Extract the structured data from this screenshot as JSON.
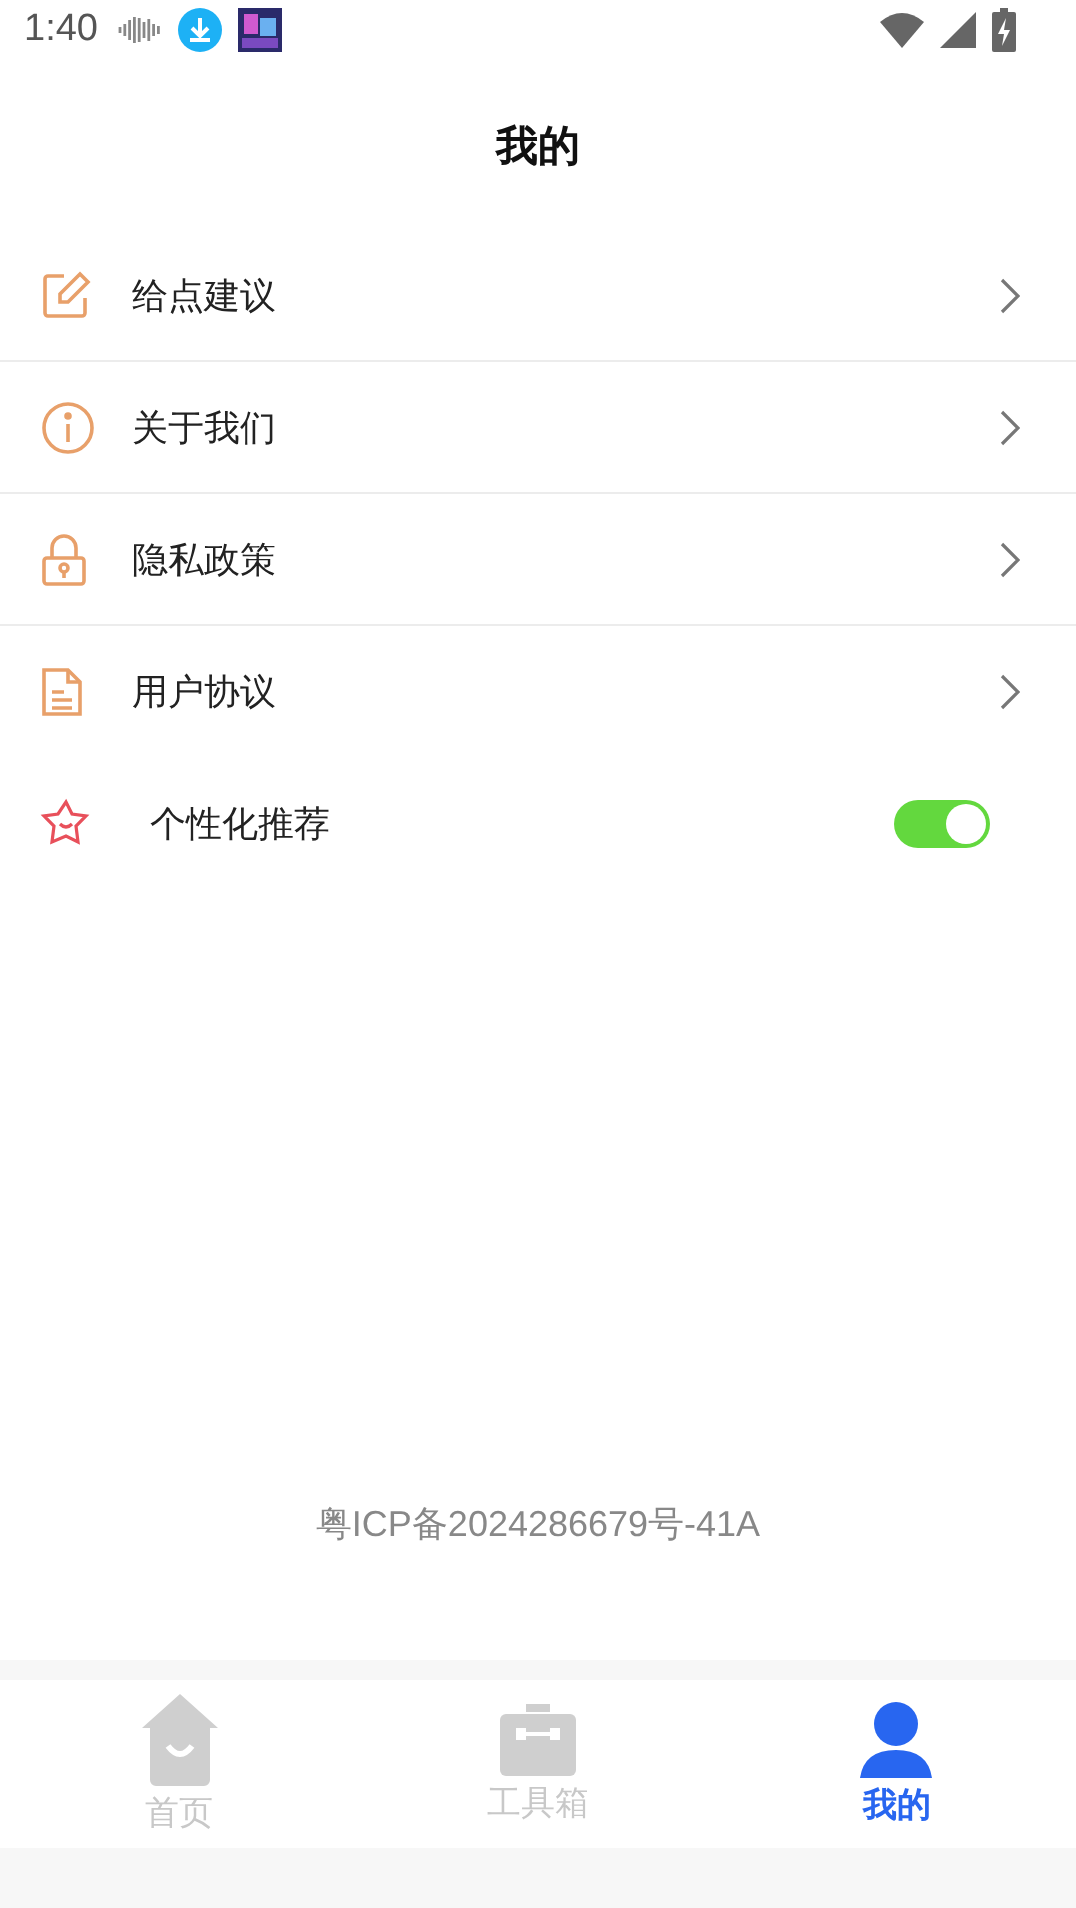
{
  "status_bar": {
    "time": "1:40"
  },
  "header": {
    "title": "我的"
  },
  "menu": [
    {
      "kind": "link",
      "label": "给点建议"
    },
    {
      "kind": "link",
      "label": "关于我们"
    },
    {
      "kind": "link",
      "label": "隐私政策"
    },
    {
      "kind": "link",
      "label": "用户协议"
    },
    {
      "kind": "toggle",
      "label": "个性化推荐",
      "on": true
    }
  ],
  "footer": {
    "text": "粤ICP备2024286679号-41A"
  },
  "tab_bar": [
    {
      "label": "首页",
      "selected": false
    },
    {
      "label": "工具箱",
      "selected": false
    },
    {
      "label": "我的",
      "selected": true
    }
  ]
}
